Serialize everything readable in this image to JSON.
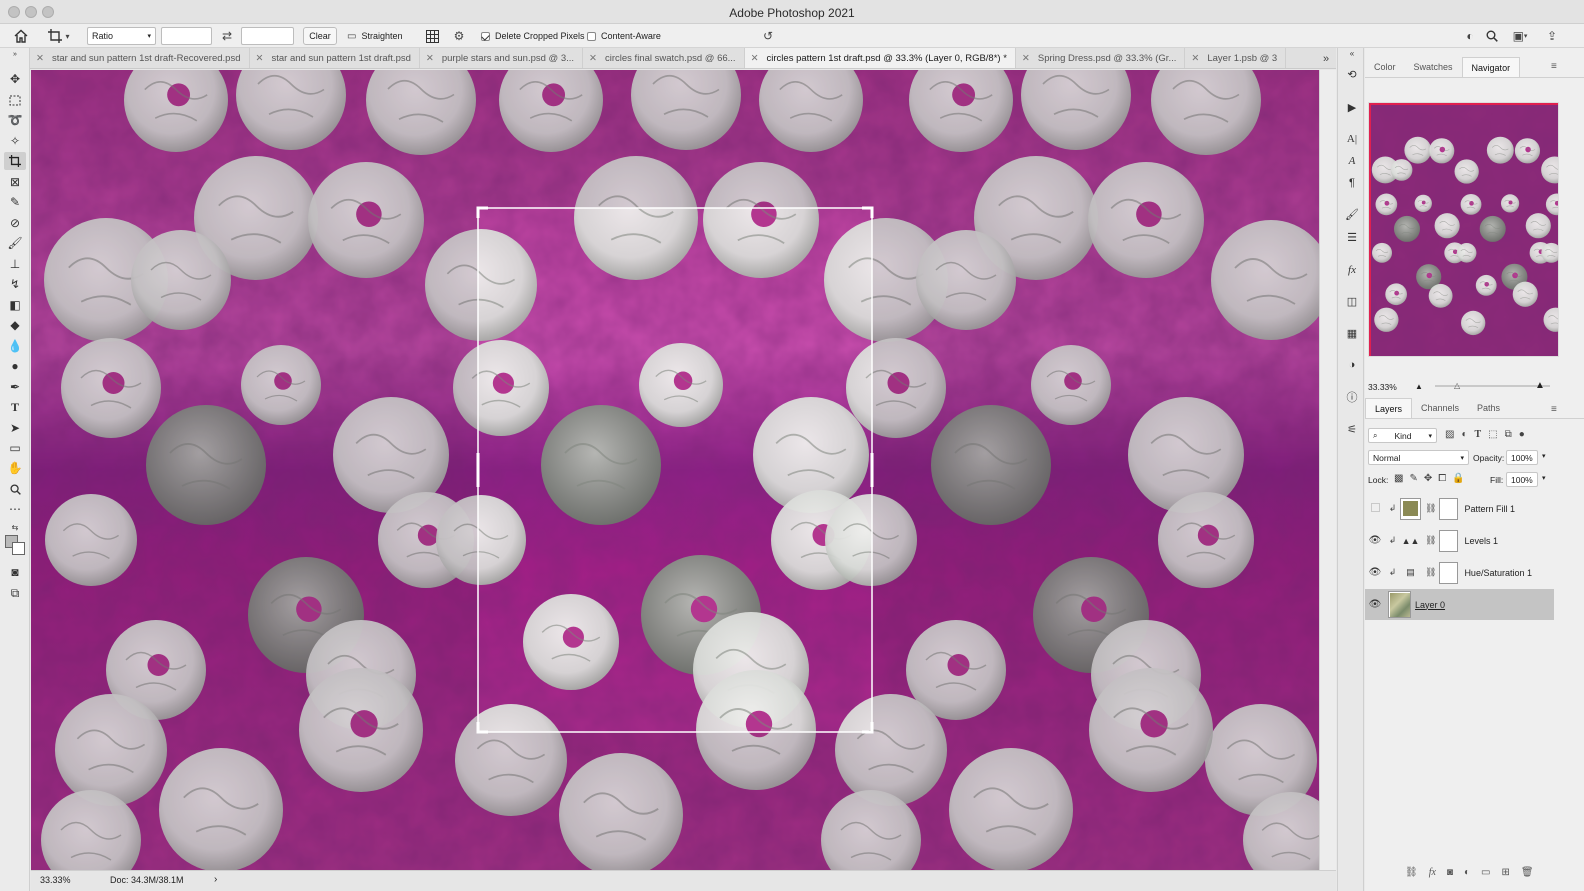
{
  "app_title": "Adobe Photoshop 2021",
  "options_bar": {
    "ratio_label": "Ratio",
    "ratio_width": "",
    "ratio_height": "",
    "clear_label": "Clear",
    "straighten_label": "Straighten",
    "delete_cropped_label": "Delete Cropped Pixels",
    "delete_cropped_checked": true,
    "content_aware_label": "Content-Aware",
    "content_aware_checked": false
  },
  "tabs": [
    {
      "label": "star and sun pattern 1st draft-Recovered.psd",
      "active": false
    },
    {
      "label": "star and sun pattern 1st draft.psd",
      "active": false
    },
    {
      "label": "purple stars and sun.psd @ 3...",
      "active": false
    },
    {
      "label": "circles final swatch.psd @ 66...",
      "active": false
    },
    {
      "label": "circles pattern 1st draft.psd @ 33.3% (Layer 0, RGB/8*) *",
      "active": true
    },
    {
      "label": "Spring Dress.psd @ 33.3% (Gr...",
      "active": false
    },
    {
      "label": "Layer 1.psb @ 3",
      "active": false
    }
  ],
  "status": {
    "zoom": "33.33%",
    "doc": "Doc: 34.3M/38.1M"
  },
  "panel_top": {
    "tabs": [
      "Color",
      "Swatches",
      "Navigator"
    ],
    "active_tab": "Navigator",
    "zoom": "33.33%",
    "zoom_level": 0.2
  },
  "layers_panel": {
    "tabs": [
      "Layers",
      "Channels",
      "Paths"
    ],
    "active_tab": "Layers",
    "filter_label": "Kind",
    "blend_mode": "Normal",
    "opacity_label": "Opacity:",
    "opacity": "100%",
    "lock_label": "Lock:",
    "fill_label": "Fill:",
    "fill": "100%",
    "layers": [
      {
        "name": "Pattern Fill 1",
        "visible": false,
        "selected": false
      },
      {
        "name": "Levels 1",
        "visible": true,
        "selected": false
      },
      {
        "name": "Hue/Saturation 1",
        "visible": true,
        "selected": false
      },
      {
        "name": "Layer 0",
        "visible": true,
        "selected": true
      }
    ]
  },
  "colors": {
    "canvas_magenta": "#b0338f",
    "canvas_dark": "#6a1456",
    "circle_light": "#e4e4e2",
    "circle_grey": "#8f958f",
    "navigator_border": "#e0204f"
  }
}
